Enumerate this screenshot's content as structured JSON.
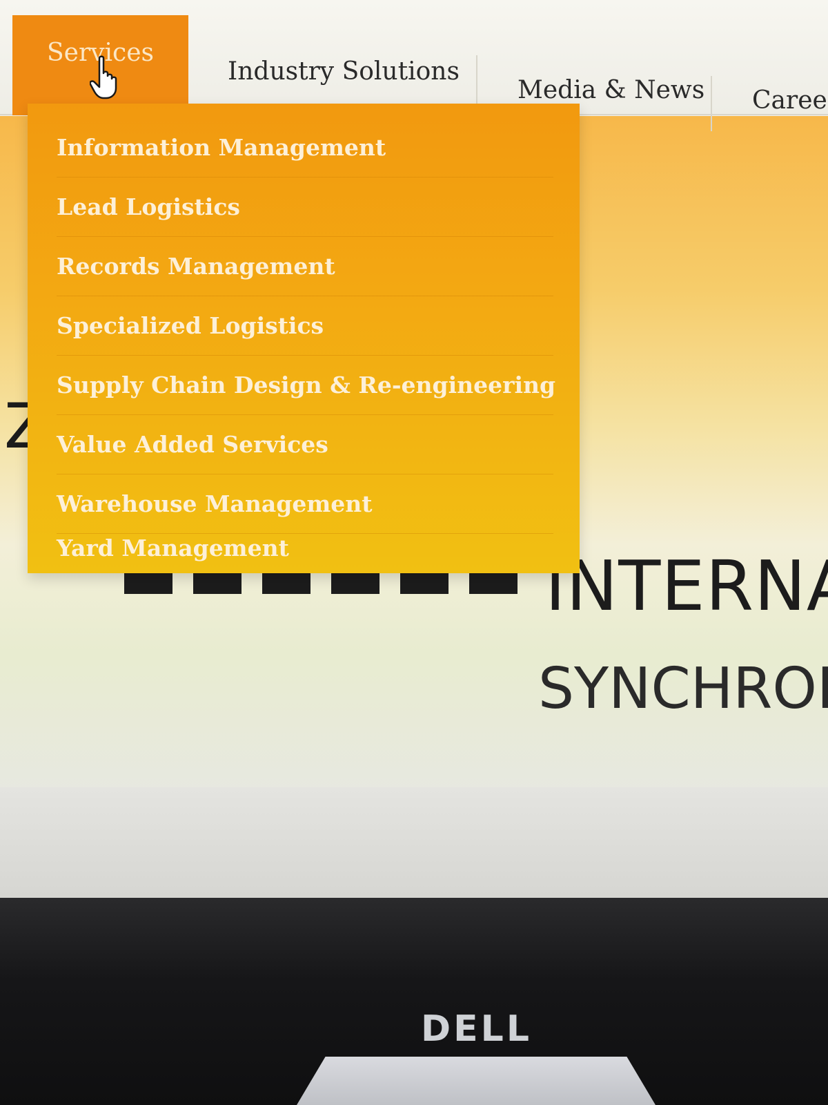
{
  "nav": {
    "items": [
      {
        "label": "Services"
      },
      {
        "label": "Industry Solutions"
      },
      {
        "label": "Media & News"
      },
      {
        "label": "Career"
      }
    ]
  },
  "dropdown": {
    "items": [
      "Information Management",
      "Lead Logistics",
      "Records Management",
      "Specialized Logistics",
      "Supply Chain Design & Re-engineering",
      "Value Added Services",
      "Warehouse Management",
      "Yard Management"
    ]
  },
  "hero": {
    "headline": "INTERNA",
    "subline": "SYNCHROI",
    "partial_char": "Z"
  },
  "monitor": {
    "brand": "DELL"
  },
  "colors": {
    "accent": "#ef8a12",
    "dropdown": "#f3a812",
    "text": "#2a2a2a"
  }
}
